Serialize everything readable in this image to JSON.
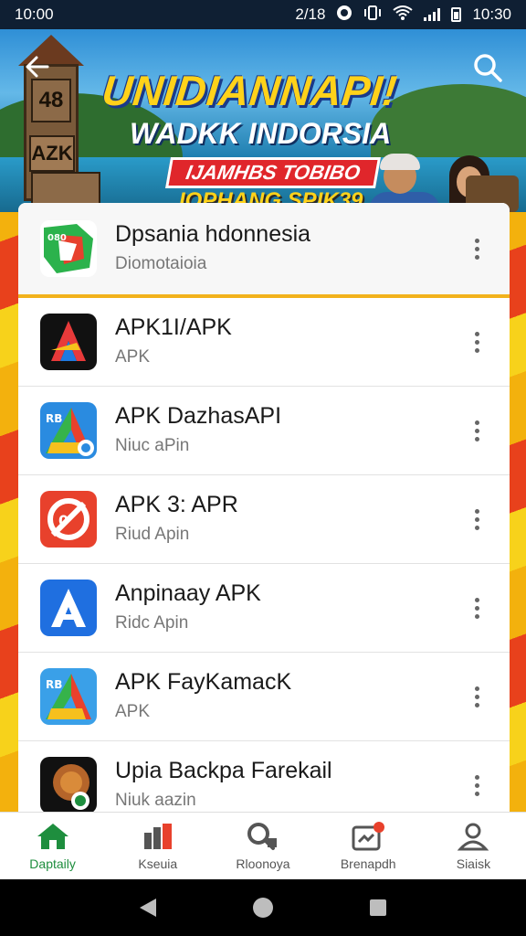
{
  "status_bar": {
    "time": "10:00",
    "notifications": "2/18",
    "clock_right": "10:30",
    "icons": [
      "shield-icon",
      "vibrate-icon",
      "wifi-icon",
      "signal-icon",
      "battery-icon"
    ]
  },
  "banner": {
    "title": "UNIDIANNAPI!",
    "subtitle": "WADKK INDORSIA",
    "red_ribbon": "IJAMHBS TOBIBO",
    "yellow_line": "IOPHANG SPIK39",
    "tower_sign_top": "48",
    "tower_sign_mid": "AZK",
    "tower_sign_base": "",
    "back_icon": "arrow-left-icon",
    "search_icon": "search-icon"
  },
  "list": {
    "header": {
      "title": "Dpsania hdonnesia",
      "subtitle": "Diomotaioia",
      "icon": "play-store-like-icon"
    },
    "items": [
      {
        "title": "APK1I/APK",
        "subtitle": "APK",
        "icon": "black-a-logo-icon"
      },
      {
        "title": "APK DazhasAPI",
        "subtitle": "Niuc aPin",
        "icon": "blue-green-a-logo-icon"
      },
      {
        "title": "APK 3: APR",
        "subtitle": "Riud Apin",
        "icon": "red-slash-logo-icon"
      },
      {
        "title": "Anpinaay APK",
        "subtitle": "Ridc Apin",
        "icon": "blue-a-logo-icon"
      },
      {
        "title": "APK FayKamacK",
        "subtitle": "APK",
        "icon": "blue-green-a-logo-icon-2"
      },
      {
        "title": "Upia Backpa Farekail",
        "subtitle": "Niuk aazin",
        "icon": "food-logo-icon"
      }
    ]
  },
  "bottom_nav": {
    "items": [
      {
        "label": "Daptaily",
        "icon": "home-icon",
        "active": true
      },
      {
        "label": "Kseuia",
        "icon": "chart-bars-icon",
        "active": false
      },
      {
        "label": "Rloonoya",
        "icon": "search-apps-icon",
        "active": false
      },
      {
        "label": "Brenapdh",
        "icon": "inbox-badge-icon",
        "active": false
      },
      {
        "label": "Siaisk",
        "icon": "person-icon",
        "active": false
      }
    ]
  },
  "colors": {
    "accent_green": "#1e8e3e",
    "banner_yellow": "#ffd21a",
    "ribbon_red": "#e0262b",
    "divider_yellow": "#f2b21c"
  }
}
